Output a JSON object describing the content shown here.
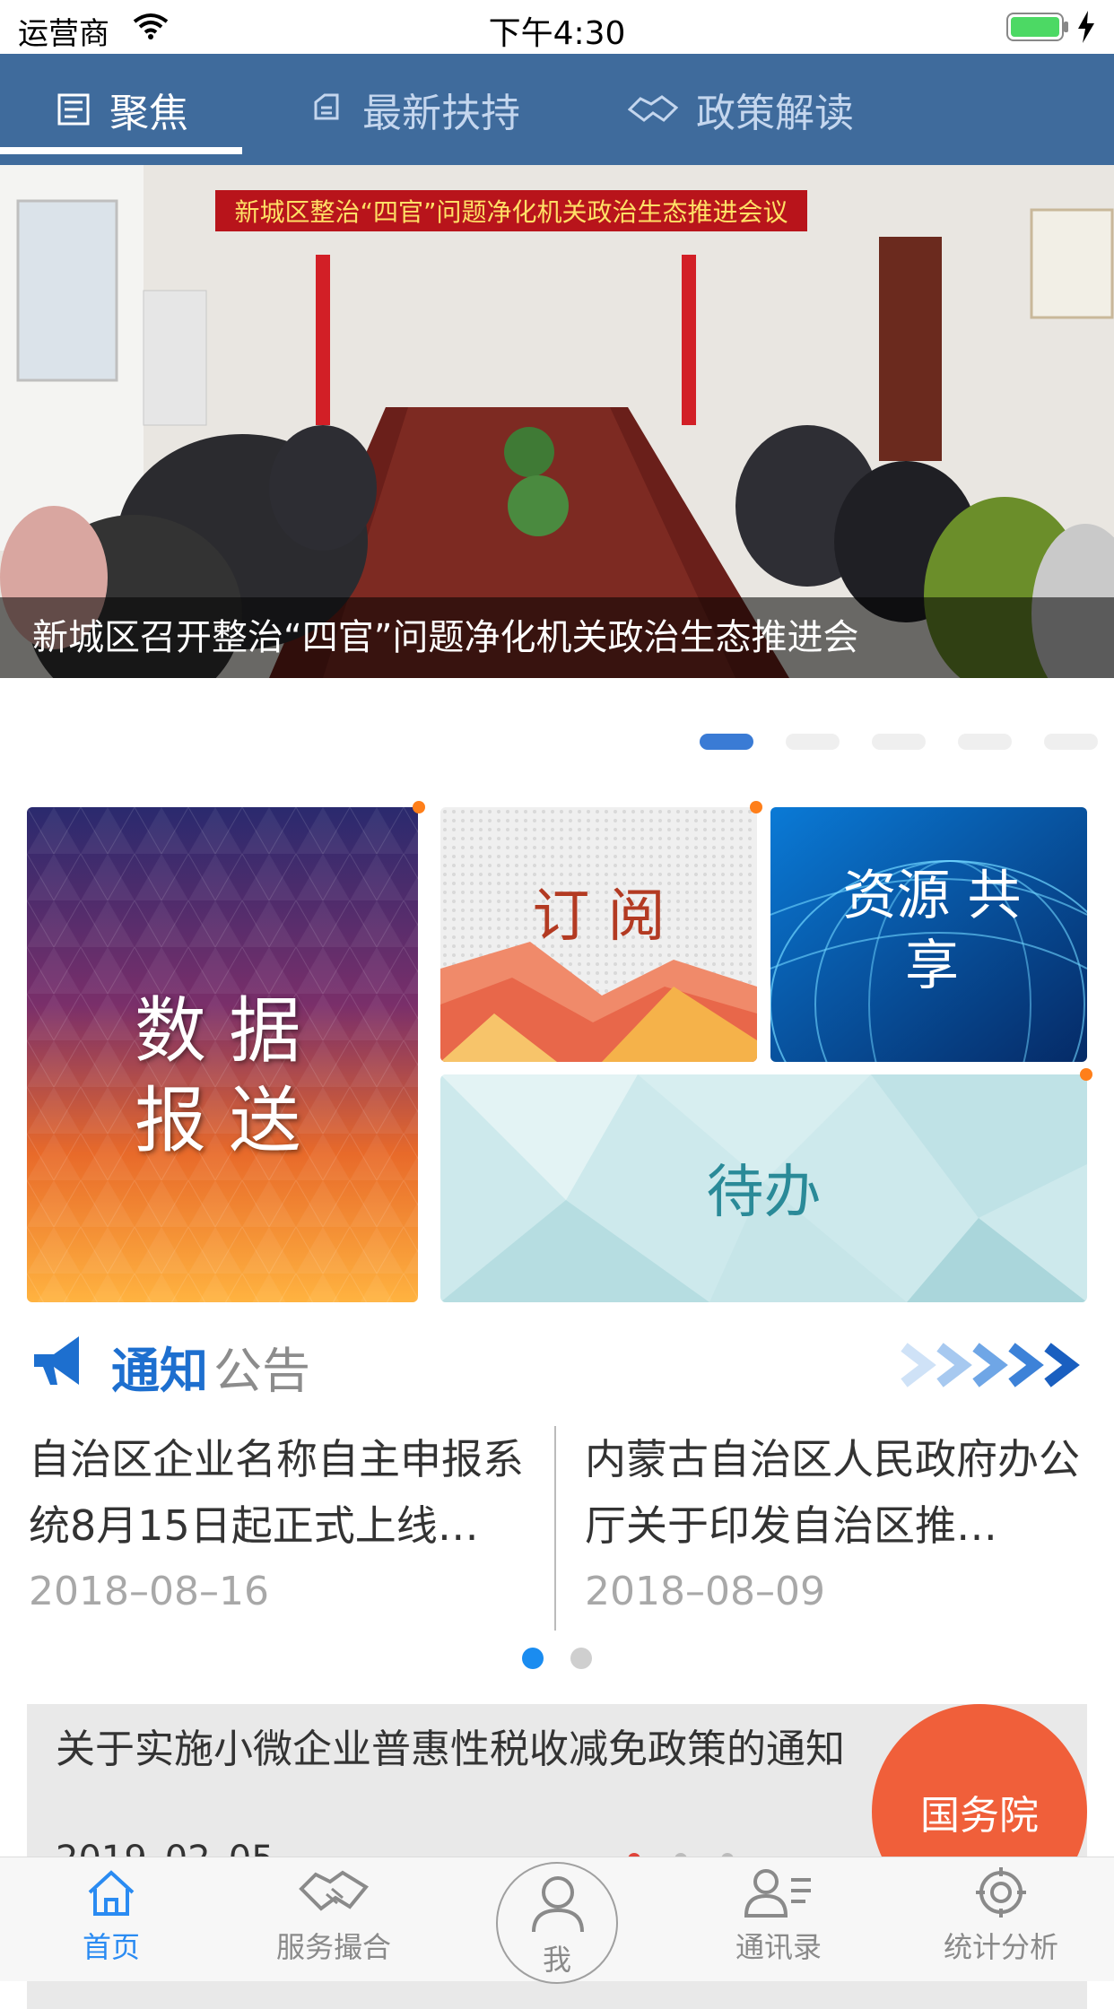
{
  "status_bar": {
    "carrier": "运营商",
    "time": "下午4:30"
  },
  "top_tabs": [
    {
      "label": "聚焦",
      "icon": "news-icon",
      "active": true
    },
    {
      "label": "最新扶持",
      "icon": "support-icon",
      "active": false
    },
    {
      "label": "政策解读",
      "icon": "handshake-icon",
      "active": false
    }
  ],
  "banner": {
    "caption": "新城区召开整治“四官”问题净化机关政治生态推进会",
    "photo_banner_text": "新城区整治“四官”问题净化机关政治生态推进会议",
    "slide_count": 5,
    "active_slide": 1
  },
  "tiles": {
    "data_report": "数 据 报 送",
    "subscribe": "订 阅",
    "resource_share": "资源 共享",
    "todo": "待办"
  },
  "notice": {
    "heading_bold": "通知",
    "heading_light": "公告",
    "items": [
      {
        "title": "自治区企业名称自主申报系统8月15日起正式上线…",
        "date": "2018–08–16"
      },
      {
        "title": "内蒙古自治区人民政府办公厅关于印发自治区推…",
        "date": "2018–08–09"
      }
    ],
    "page_count": 2,
    "active_page": 1
  },
  "policy": {
    "title": "关于实施小微企业普惠性税收减免政策的通知",
    "date_partial": "2019–02–05",
    "badge": "国务院"
  },
  "bottom_tabs": [
    {
      "label": "首页",
      "icon": "home-icon",
      "active": true
    },
    {
      "label": "服务撮合",
      "icon": "handshake-icon",
      "active": false
    },
    {
      "label": "我",
      "icon": "user-icon",
      "active": false
    },
    {
      "label": "通讯录",
      "icon": "contacts-icon",
      "active": false
    },
    {
      "label": "统计分析",
      "icon": "target-icon",
      "active": false
    }
  ],
  "colors": {
    "nav_blue": "#3f6b9c",
    "accent_blue": "#2a8bf2",
    "badge_orange": "#f05f3a",
    "notif_dot": "#ff7f1a"
  }
}
